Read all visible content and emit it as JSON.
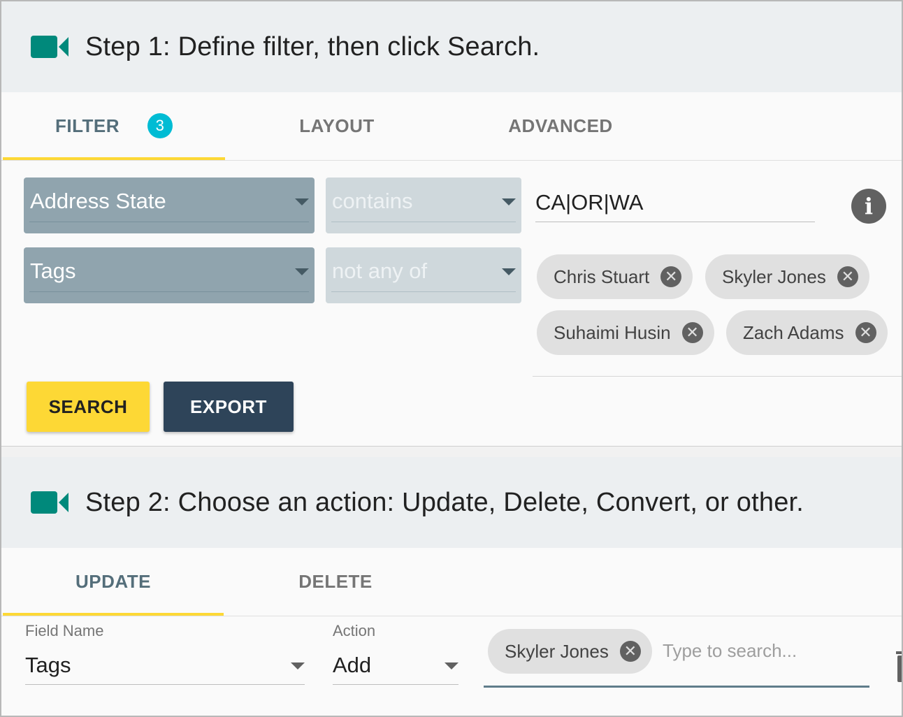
{
  "step1": {
    "title": "Step 1: Define filter, then click Search.",
    "icon": "video-camera-icon",
    "tabs": [
      {
        "label": "FILTER",
        "badge": "3",
        "active": true
      },
      {
        "label": "LAYOUT",
        "active": false
      },
      {
        "label": "ADVANCED",
        "active": false
      }
    ],
    "filters": [
      {
        "field": "Address State",
        "operator": "contains",
        "value": "CA|OR|WA"
      },
      {
        "field": "Tags",
        "operator": "not any of",
        "chips": [
          "Chris Stuart",
          "Skyler Jones",
          "Suhaimi Husin",
          "Zach Adams"
        ]
      }
    ],
    "info_icon": "info-icon",
    "buttons": {
      "search": "SEARCH",
      "export": "EXPORT"
    }
  },
  "step2": {
    "title": "Step 2: Choose an action: Update, Delete, Convert, or other.",
    "icon": "video-camera-icon",
    "tabs": [
      {
        "label": "UPDATE",
        "active": true
      },
      {
        "label": "DELETE",
        "active": false
      }
    ],
    "field_name": {
      "label": "Field Name",
      "value": "Tags"
    },
    "action": {
      "label": "Action",
      "value": "Add"
    },
    "selected_chips": [
      "Skyler Jones"
    ],
    "search_placeholder": "Type to search..."
  },
  "colors": {
    "accent": "#fdd835",
    "teal": "#00897b",
    "badge": "#00bcd4",
    "export_button": "#2e4459",
    "select_dark": "#90a4ae",
    "select_light": "#cfd8dc"
  }
}
